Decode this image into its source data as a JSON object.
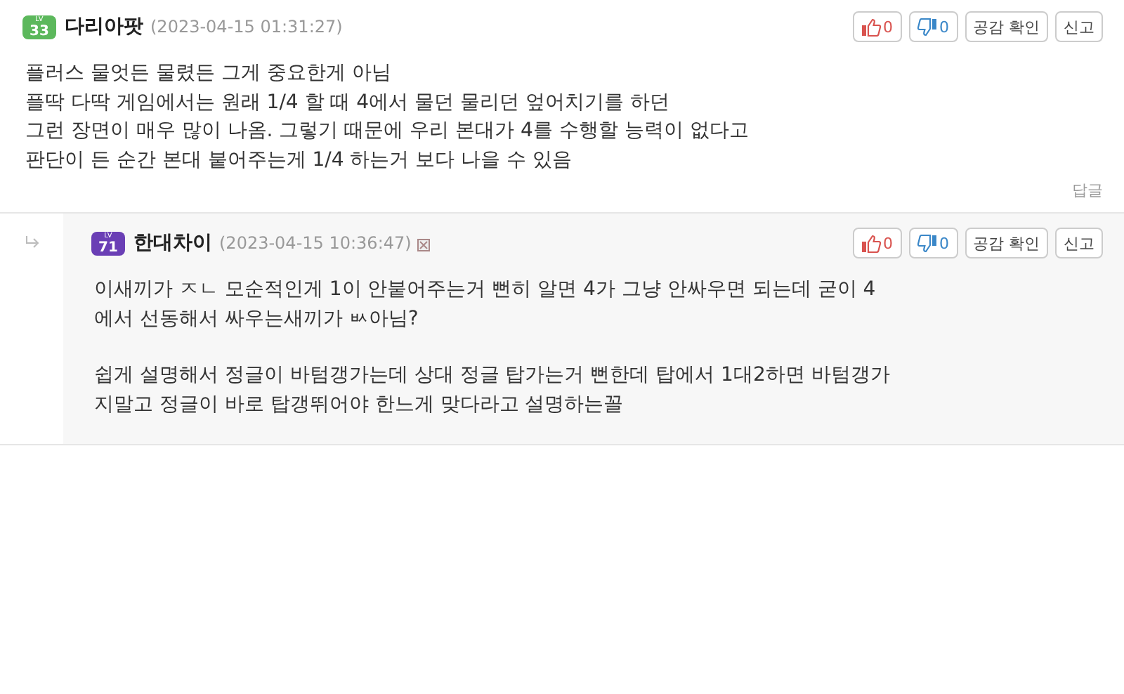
{
  "comments": [
    {
      "kind": "comment",
      "badge_label": "LV",
      "badge": "33",
      "color": "#5cb85c",
      "nickname": "다리아팟",
      "time": "(2023-04-15 01:31:27)",
      "flag_icon": false,
      "likes": "0",
      "dislikes": "0",
      "empathy_button": "공감 확인",
      "report_button": "신고",
      "paragraphs": [
        [
          "플러스 물엇든 물렸든 그게 중요한게 아님",
          "플딱 다딱 게임에서는 원래 1/4 할 때 4에서 물던 물리던 엎어치기를 하던",
          "그런 장면이 매우 많이 나옴. 그렇기 때문에 우리 본대가 4를 수행할 능력이 없다고",
          "판단이 든 순간 본대 붙어주는게 1/4 하는거 보다 나을 수 있음"
        ]
      ],
      "reply_link": "답글"
    },
    {
      "kind": "reply",
      "badge_label": "LV",
      "badge": "71",
      "color": "#6a3fb5",
      "nickname": "한대차이",
      "time": "(2023-04-15 10:36:47)",
      "flag_icon": true,
      "likes": "0",
      "dislikes": "0",
      "empathy_button": "공감 확인",
      "report_button": "신고",
      "paragraphs": [
        [
          "이새끼가 ㅈㄴ 모순적인게 1이 안붙어주는거 뻔히 알면 4가 그냥 안싸우면 되는데 굳이 4",
          "에서 선동해서 싸우는새끼가 ㅄ아님?"
        ],
        [
          "쉽게 설명해서 정글이 바텀갱가는데 상대 정글 탑가는거 뻔한데 탑에서 1대2하면 바텀갱가",
          "지말고 정글이 바로 탑갱뛰어야 한느게 맞다라고 설명하는꼴"
        ]
      ]
    }
  ]
}
